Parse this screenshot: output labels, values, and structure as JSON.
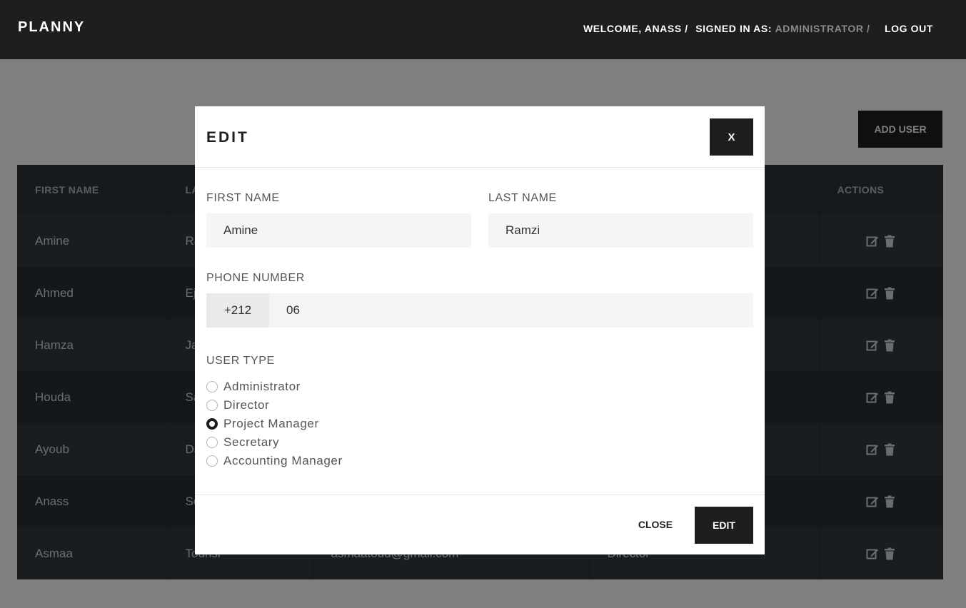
{
  "header": {
    "brand": "PLANNY",
    "welcome": "WELCOME, ANASS /",
    "signed_in_label": "SIGNED IN AS:",
    "role": "ADMINISTRATOR /",
    "logout": "LOG OUT"
  },
  "toolbar": {
    "add_user_label": "ADD USER"
  },
  "table": {
    "columns": [
      "FIRST NAME",
      "LA",
      "",
      "",
      "ACTIONS"
    ],
    "rows": [
      [
        "Amine",
        "Ra",
        "",
        "",
        ""
      ],
      [
        "Ahmed",
        "Ej",
        "",
        "",
        ""
      ],
      [
        "Hamza",
        "Ja",
        "",
        "",
        ""
      ],
      [
        "Houda",
        "Sa",
        "",
        "",
        ""
      ],
      [
        "Ayoub",
        "Da",
        "",
        "",
        ""
      ],
      [
        "Anass",
        "So",
        "",
        "",
        ""
      ],
      [
        "Asmaa",
        "Tounsi",
        "asmaatoud@gmail.com",
        "Director",
        ""
      ]
    ]
  },
  "modal": {
    "title": "EDIT",
    "close_x": "X",
    "first_name_label": "FIRST NAME",
    "first_name_value": "Amine",
    "last_name_label": "LAST NAME",
    "last_name_value": "Ramzi",
    "phone_label": "PHONE NUMBER",
    "phone_prefix": "+212",
    "phone_value": "06",
    "user_type_label": "USER TYPE",
    "user_types": [
      "Administrator",
      "Director",
      "Project Manager",
      "Secretary",
      "Accounting Manager"
    ],
    "selected_user_type": "Project Manager",
    "close_button": "CLOSE",
    "edit_button": "EDIT"
  },
  "colors": {
    "dark": "#1e1e1e",
    "table_header": "#2f353b",
    "overlay": "rgba(0,0,0,0.5)"
  }
}
